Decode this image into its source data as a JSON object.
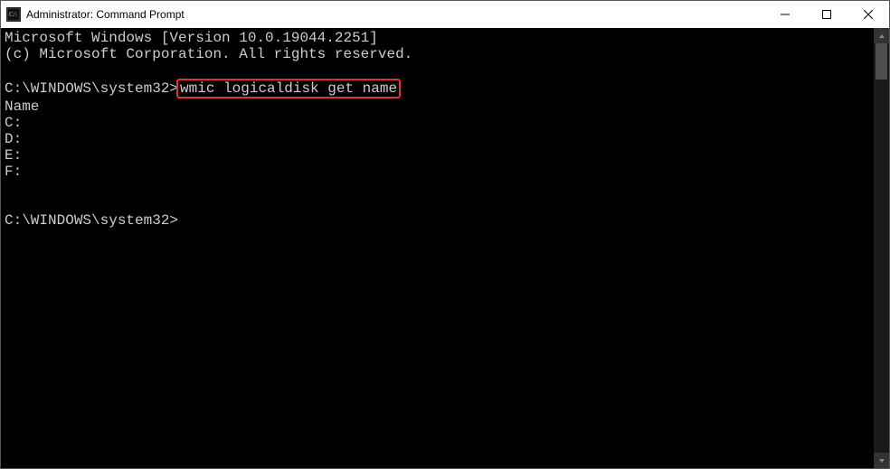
{
  "window": {
    "title": "Administrator: Command Prompt"
  },
  "terminal": {
    "header_line1": "Microsoft Windows [Version 10.0.19044.2251]",
    "header_line2": "(c) Microsoft Corporation. All rights reserved.",
    "prompt1_path": "C:\\WINDOWS\\system32>",
    "command_highlighted": "wmic logicaldisk get name",
    "output_header": "Name",
    "output_rows": {
      "r0": "C:",
      "r1": "D:",
      "r2": "E:",
      "r3": "F:"
    },
    "prompt2_path": "C:\\WINDOWS\\system32>"
  }
}
